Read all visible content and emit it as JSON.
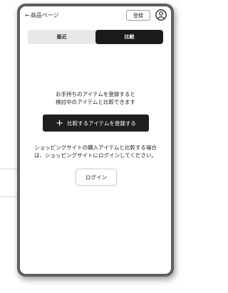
{
  "header": {
    "back_label": "商品ページ",
    "login_label": "登録",
    "user_icon": "user-circle-icon"
  },
  "tabs": [
    {
      "label": "最近",
      "active": false
    },
    {
      "label": "比較",
      "active": true
    }
  ],
  "main": {
    "intro_line1": "お手持ちのアイテムを登録すると",
    "intro_line2": "検討中のアイテムと比較できます",
    "add_button_label": "比較するアイテムを登録する",
    "add_icon": "plus-icon",
    "note_line1": "ショッピングサイトの購入アイテムと比較する場合",
    "note_line2": "は、ショッピングサイトにログインしてください。",
    "login_button_label": "ログイン"
  },
  "colors": {
    "accent_dark": "#1f1f1f",
    "panel_border": "#5f5f5f",
    "tab_track": "#e8e8e8"
  }
}
